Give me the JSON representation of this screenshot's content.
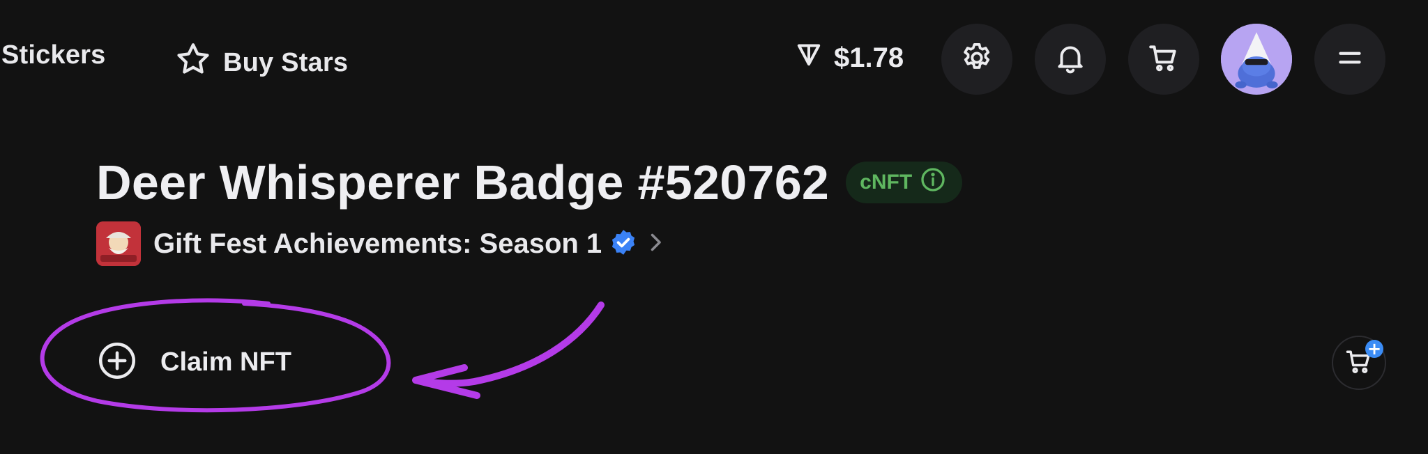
{
  "header": {
    "nav": [
      {
        "label": "Stickers"
      },
      {
        "label": "Buy Stars",
        "icon": "star-icon"
      }
    ],
    "balance": {
      "value": "$1.78",
      "icon": "ton-icon"
    },
    "buttons": [
      {
        "icon": "gear-icon"
      },
      {
        "icon": "bell-icon"
      },
      {
        "icon": "cart-icon"
      },
      {
        "icon": "avatar"
      },
      {
        "icon": "menu-icon"
      }
    ]
  },
  "item": {
    "title": "Deer Whisperer Badge #520762",
    "badge": "cNFT",
    "collection": {
      "name": "Gift Fest Achievements: Season 1",
      "verified": true
    }
  },
  "actions": {
    "claim_label": "Claim NFT"
  },
  "colors": {
    "background": "#121212",
    "badge_bg": "#15291a",
    "badge_text": "#5fb760",
    "verified_blue": "#3b82f6",
    "annotation": "#b43be8",
    "avatar_bg": "#b7a4f2"
  }
}
